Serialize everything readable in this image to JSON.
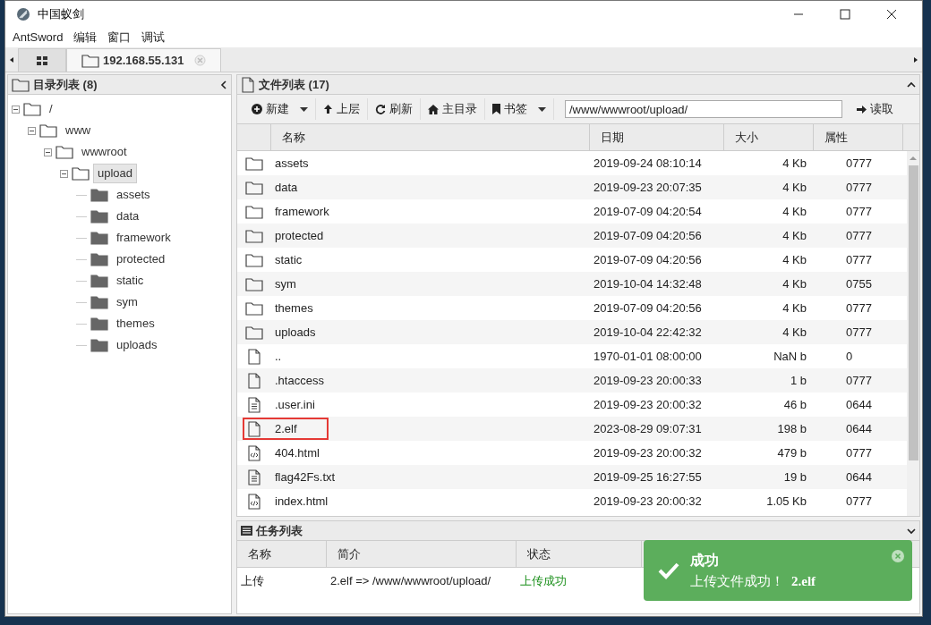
{
  "window": {
    "title": "中国蚁剑"
  },
  "menu": [
    "AntSword",
    "编辑",
    "窗口",
    "调试"
  ],
  "tabs": [
    {
      "kind": "grid",
      "selected": false
    },
    {
      "kind": "host",
      "label": "192.168.55.131",
      "selected": true
    }
  ],
  "dir_panel": {
    "title": "目录列表 (8)",
    "tree": [
      {
        "name": "/",
        "expanded": true,
        "children": [
          {
            "name": "www",
            "expanded": true,
            "children": [
              {
                "name": "wwwroot",
                "expanded": true,
                "children": [
                  {
                    "name": "upload",
                    "expanded": true,
                    "selected": true,
                    "children": [
                      {
                        "name": "assets",
                        "selected": false
                      },
                      {
                        "name": "data",
                        "selected": false
                      },
                      {
                        "name": "framework",
                        "selected": false
                      },
                      {
                        "name": "protected",
                        "selected": false
                      },
                      {
                        "name": "static",
                        "selected": false
                      },
                      {
                        "name": "sym",
                        "selected": false
                      },
                      {
                        "name": "themes",
                        "selected": false
                      },
                      {
                        "name": "uploads",
                        "selected": false
                      }
                    ]
                  }
                ]
              }
            ]
          }
        ]
      }
    ]
  },
  "file_panel": {
    "title": "文件列表 (17)",
    "toolbar": [
      {
        "kind": "new",
        "label": "新建",
        "dropdown": true
      },
      {
        "kind": "up",
        "label": "上层",
        "dropdown": false
      },
      {
        "kind": "refresh",
        "label": "刷新",
        "dropdown": false
      },
      {
        "kind": "home",
        "label": "主目录",
        "dropdown": false
      },
      {
        "kind": "bookmark",
        "label": "书签",
        "dropdown": true
      }
    ],
    "path": "/www/wwwroot/upload/",
    "read_button": "读取",
    "columns": [
      "名称",
      "日期",
      "大小",
      "属性"
    ],
    "rows": [
      {
        "kind": "folder",
        "name": "assets",
        "date": "2019-09-24 08:10:14",
        "size": "4 Kb",
        "mode": "0777",
        "outlined": false
      },
      {
        "kind": "folder",
        "name": "data",
        "date": "2019-09-23 20:07:35",
        "size": "4 Kb",
        "mode": "0777",
        "outlined": false
      },
      {
        "kind": "folder",
        "name": "framework",
        "date": "2019-07-09 04:20:54",
        "size": "4 Kb",
        "mode": "0777",
        "outlined": false
      },
      {
        "kind": "folder",
        "name": "protected",
        "date": "2019-07-09 04:20:56",
        "size": "4 Kb",
        "mode": "0777",
        "outlined": false
      },
      {
        "kind": "folder",
        "name": "static",
        "date": "2019-07-09 04:20:56",
        "size": "4 Kb",
        "mode": "0777",
        "outlined": false
      },
      {
        "kind": "folder",
        "name": "sym",
        "date": "2019-10-04 14:32:48",
        "size": "4 Kb",
        "mode": "0755",
        "outlined": false
      },
      {
        "kind": "folder",
        "name": "themes",
        "date": "2019-07-09 04:20:56",
        "size": "4 Kb",
        "mode": "0777",
        "outlined": false
      },
      {
        "kind": "folder",
        "name": "uploads",
        "date": "2019-10-04 22:42:32",
        "size": "4 Kb",
        "mode": "0777",
        "outlined": false
      },
      {
        "kind": "file",
        "name": "..",
        "date": "1970-01-01 08:00:00",
        "size": "NaN b",
        "mode": "0",
        "outlined": false
      },
      {
        "kind": "file",
        "name": ".htaccess",
        "date": "2019-09-23 20:00:33",
        "size": "1 b",
        "mode": "0777",
        "outlined": false
      },
      {
        "kind": "text",
        "name": ".user.ini",
        "date": "2019-09-23 20:00:32",
        "size": "46 b",
        "mode": "0644",
        "outlined": false
      },
      {
        "kind": "file",
        "name": "2.elf",
        "date": "2023-08-29 09:07:31",
        "size": "198 b",
        "mode": "0644",
        "outlined": true
      },
      {
        "kind": "code",
        "name": "404.html",
        "date": "2019-09-23 20:00:32",
        "size": "479 b",
        "mode": "0777",
        "outlined": false
      },
      {
        "kind": "text",
        "name": "flag42Fs.txt",
        "date": "2019-09-25 16:27:55",
        "size": "19 b",
        "mode": "0644",
        "outlined": false
      },
      {
        "kind": "code",
        "name": "index.html",
        "date": "2019-09-23 20:00:32",
        "size": "1.05 Kb",
        "mode": "0777",
        "outlined": false
      }
    ]
  },
  "task_panel": {
    "title": "任务列表",
    "columns": [
      "名称",
      "简介",
      "状态"
    ],
    "rows": [
      {
        "name": "上传",
        "summary": "2.elf => /www/wwwroot/upload/",
        "status": "上传成功",
        "success": true
      }
    ]
  },
  "toast": {
    "title": "成功",
    "message": "上传文件成功！",
    "file": "2.elf"
  }
}
